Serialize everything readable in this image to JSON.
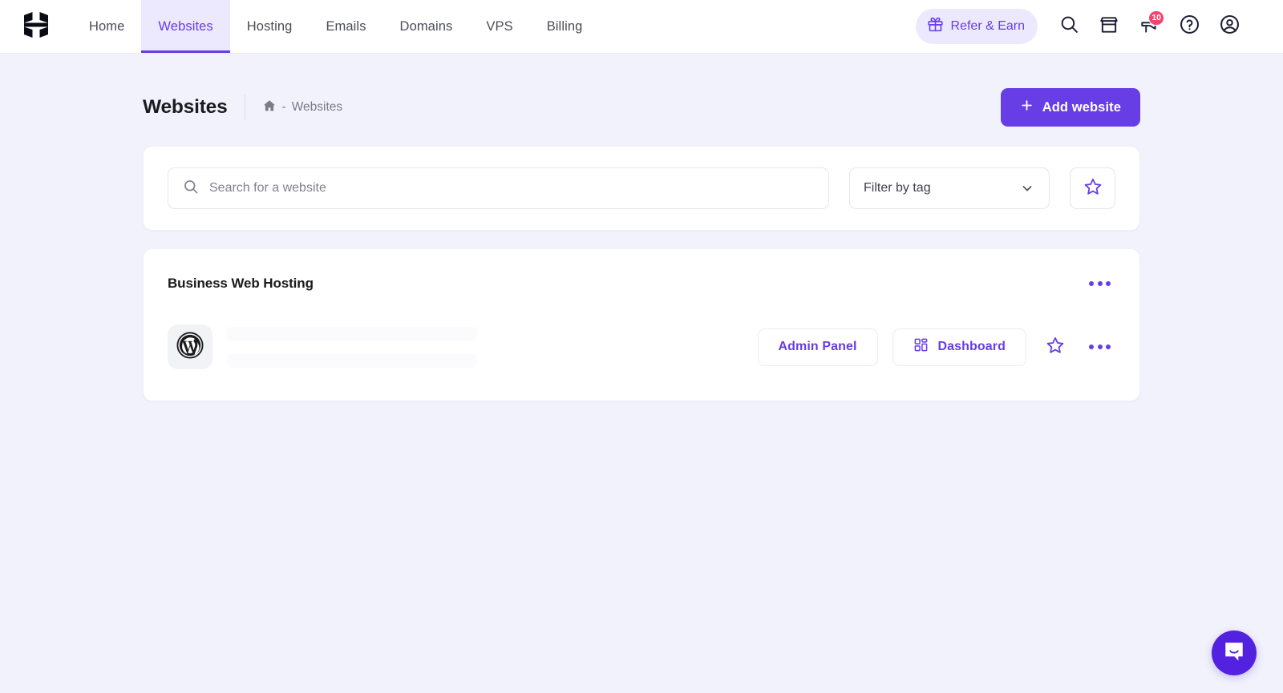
{
  "brand": {
    "logo_name": "hostinger-logo",
    "accent": "#673de6",
    "accent_soft": "#ece9fe",
    "page_bg": "#f2f2fd",
    "badge_color": "#f0456f"
  },
  "topnav": {
    "items": [
      {
        "label": "Home",
        "active": false
      },
      {
        "label": "Websites",
        "active": true
      },
      {
        "label": "Hosting",
        "active": false
      },
      {
        "label": "Emails",
        "active": false
      },
      {
        "label": "Domains",
        "active": false
      },
      {
        "label": "VPS",
        "active": false
      },
      {
        "label": "Billing",
        "active": false
      }
    ],
    "refer": {
      "label": "Refer & Earn",
      "icon": "gift-icon"
    },
    "actions": [
      {
        "name": "search-icon",
        "label": "Search"
      },
      {
        "name": "store-icon",
        "label": "Marketplace"
      },
      {
        "name": "megaphone-icon",
        "label": "Announcements",
        "badge": "10"
      },
      {
        "name": "help-icon",
        "label": "Help"
      },
      {
        "name": "account-icon",
        "label": "Account"
      }
    ]
  },
  "header": {
    "title": "Websites",
    "breadcrumb": {
      "home_icon": "home-icon",
      "separator": "-",
      "current": "Websites"
    },
    "add_button": {
      "label": "Add website",
      "icon": "plus-icon"
    }
  },
  "filters": {
    "search": {
      "placeholder": "Search for a website",
      "value": "",
      "icon": "search-icon"
    },
    "tag_select": {
      "label": "Filter by tag",
      "icon": "chevron-down-icon"
    },
    "favorites_button": {
      "icon": "star-icon",
      "label": "Favorites"
    }
  },
  "websites_section": {
    "title": "Business Web Hosting",
    "menu_icon": "ellipsis-icon",
    "rows": [
      {
        "platform_icon": "wordpress-icon",
        "name_placeholder": "",
        "url_placeholder": "",
        "admin_button": {
          "label": "Admin Panel"
        },
        "dashboard_button": {
          "label": "Dashboard",
          "icon": "grid-icon"
        },
        "favorite_icon": "star-icon",
        "menu_icon": "ellipsis-icon"
      }
    ]
  },
  "chat": {
    "name": "intercom-launcher",
    "icon": "chat-bubble-icon"
  }
}
